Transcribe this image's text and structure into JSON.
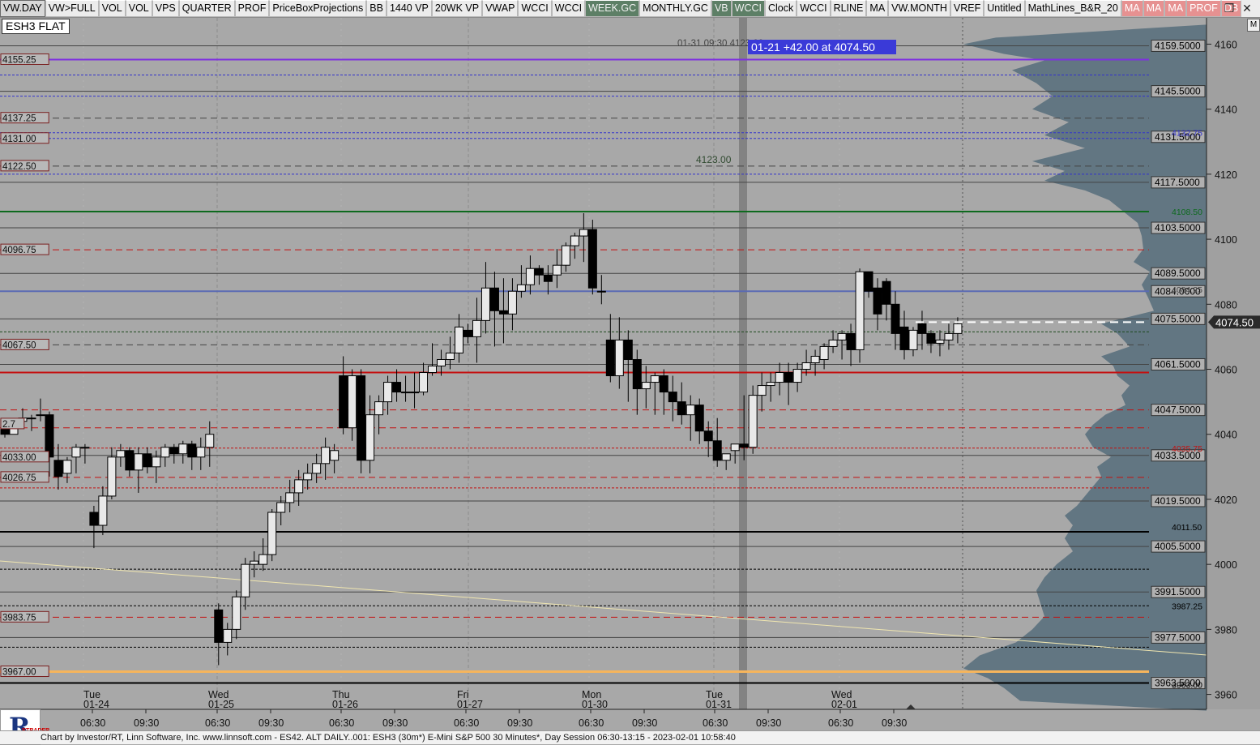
{
  "toolbar": {
    "items": [
      {
        "label": "VW.DAY",
        "style": "active"
      },
      {
        "label": "VW>FULL",
        "style": ""
      },
      {
        "label": "VOL",
        "style": ""
      },
      {
        "label": "VOL",
        "style": ""
      },
      {
        "label": "VPS",
        "style": ""
      },
      {
        "label": "QUARTER",
        "style": ""
      },
      {
        "label": "PROF",
        "style": ""
      },
      {
        "label": "PriceBoxProjections",
        "style": ""
      },
      {
        "label": "BB",
        "style": ""
      },
      {
        "label": "1440 VP",
        "style": ""
      },
      {
        "label": "20WK VP",
        "style": ""
      },
      {
        "label": "VWAP",
        "style": ""
      },
      {
        "label": "WCCI",
        "style": ""
      },
      {
        "label": "WCCI",
        "style": ""
      },
      {
        "label": "WEEK.GC",
        "style": "green"
      },
      {
        "label": "MONTHLY.GC",
        "style": ""
      },
      {
        "label": "VB",
        "style": "green"
      },
      {
        "label": "WCCI",
        "style": "green"
      },
      {
        "label": "Clock",
        "style": ""
      },
      {
        "label": "WCCI",
        "style": ""
      },
      {
        "label": "RLINE",
        "style": ""
      },
      {
        "label": "MA",
        "style": ""
      },
      {
        "label": "VW.MONTH",
        "style": ""
      },
      {
        "label": "VREF",
        "style": ""
      },
      {
        "label": "Untitled",
        "style": ""
      },
      {
        "label": "MathLines_B&R_20",
        "style": ""
      },
      {
        "label": "MA",
        "style": "red"
      },
      {
        "label": "MA",
        "style": "red"
      },
      {
        "label": "MA",
        "style": "red"
      },
      {
        "label": "PROF",
        "style": "red"
      },
      {
        "label": "DB",
        "style": "red"
      }
    ],
    "window_controls": [
      "❐",
      "✕"
    ]
  },
  "symbol": "ESH3 FLAT",
  "m_button": "M",
  "footer_text": "Chart by Investor/RT, Linn Software, Inc. www.linnsoft.com - ES42.  ALT DAILY..001: ESH3 (30m*) E-Mini S&P 500 30 Minutes*, Day Session 06:30-13:15 - 2023-02-01 10:58:40",
  "logo_text": "R",
  "logo_subtext": "RTRADER",
  "colors": {
    "bg": "#a8a8a8",
    "profile": "#5e7380",
    "purple": "#7e2fe0",
    "red": "#c41010",
    "green": "#0e6a1e",
    "orange": "#f6b55c",
    "blue": "#5a6ab4",
    "label_blue": "#3333cc"
  },
  "chart_data": {
    "type": "candlestick",
    "title": "ESH3 (30m*) E-Mini S&P 500 30 Minutes",
    "y_ticks": [
      4160,
      4140,
      4120,
      4100,
      4080,
      4060,
      4040,
      4020,
      4000,
      3980,
      3960
    ],
    "last_price": "4074.50",
    "price_annotation": "01-21 +42.00 at 4074.50",
    "price_annotation_ghost": "01-31 09:30 4123.00",
    "level_4123": "4123.00",
    "x_days": [
      {
        "day": "Tue",
        "date": "01-24",
        "times": [
          "06:30",
          "09:30"
        ]
      },
      {
        "day": "Wed",
        "date": "01-25",
        "times": [
          "06:30",
          "09:30"
        ]
      },
      {
        "day": "Thu",
        "date": "01-26",
        "times": [
          "06:30",
          "09:30"
        ]
      },
      {
        "day": "Fri",
        "date": "01-27",
        "times": [
          "06:30",
          "09:30"
        ]
      },
      {
        "day": "Mon",
        "date": "01-30",
        "times": [
          "06:30",
          "09:30"
        ]
      },
      {
        "day": "Tue",
        "date": "01-31",
        "times": [
          "06:30",
          "09:30"
        ]
      },
      {
        "day": "Wed",
        "date": "02-01",
        "times": [
          "06:30",
          "09:30"
        ]
      }
    ],
    "left_labels": [
      "4155.25",
      "4137.25",
      "4131.00",
      "4122.50",
      "4096.75",
      "4067.50",
      "2.7",
      "4033.00",
      "4026.75",
      "3983.75",
      "3967.00"
    ],
    "left_label_prices": [
      4155.25,
      4137.25,
      4131.0,
      4122.5,
      4096.75,
      4067.5,
      4043.2,
      4033.0,
      4026.75,
      3983.75,
      3967.0
    ],
    "right_box_labels": [
      "4159.5000",
      "4145.5000",
      "4131.5000",
      "4117.5000",
      "4103.5000",
      "4089.5000",
      "4084.0000",
      "4075.5000",
      "4061.5000",
      "4047.5000",
      "4033.5000",
      "4019.5000",
      "4005.5000",
      "3991.5000",
      "3977.5000",
      "3963.5000"
    ],
    "right_plain_labels": [
      {
        "text": "4132.75",
        "price": 4132.75,
        "color": "#3333cc"
      },
      {
        "text": "4108.50",
        "price": 4108.5,
        "color": "#0e6a1e"
      },
      {
        "text": "4084.25",
        "price": 4084.6,
        "color": "#444"
      },
      {
        "text": "4035.75",
        "price": 4035.75,
        "color": "#c41010"
      },
      {
        "text": "4011.50",
        "price": 4011.5,
        "color": "#000"
      },
      {
        "text": "3987.25",
        "price": 3987.25,
        "color": "#000"
      },
      {
        "text": "3963.00",
        "price": 3963.0,
        "color": "#000"
      }
    ],
    "h_lines": [
      {
        "p": 4155.25,
        "c": "#7e2fe0",
        "w": 2,
        "d": ""
      },
      {
        "p": 4159.5,
        "c": "#444",
        "w": 1,
        "d": ""
      },
      {
        "p": 4150.5,
        "c": "#3333cc",
        "w": 1,
        "d": "3,2"
      },
      {
        "p": 4145.5,
        "c": "#444",
        "w": 1,
        "d": ""
      },
      {
        "p": 4144.0,
        "c": "#3333cc",
        "w": 1,
        "d": "3,2"
      },
      {
        "p": 4137.25,
        "c": "#444",
        "w": 1,
        "d": "8,5"
      },
      {
        "p": 4132.75,
        "c": "#3333cc",
        "w": 1,
        "d": "3,2"
      },
      {
        "p": 4131.0,
        "c": "#3333cc",
        "w": 1,
        "d": "3,2"
      },
      {
        "p": 4122.5,
        "c": "#444",
        "w": 1,
        "d": "8,5"
      },
      {
        "p": 4120.0,
        "c": "#3333cc",
        "w": 1,
        "d": "3,2"
      },
      {
        "p": 4117.5,
        "c": "#444",
        "w": 1,
        "d": ""
      },
      {
        "p": 4108.5,
        "c": "#0e6a1e",
        "w": 2,
        "d": ""
      },
      {
        "p": 4103.5,
        "c": "#444",
        "w": 1,
        "d": ""
      },
      {
        "p": 4096.75,
        "c": "#c41010",
        "w": 1,
        "d": "8,5"
      },
      {
        "p": 4089.5,
        "c": "#444",
        "w": 1,
        "d": ""
      },
      {
        "p": 4084.0,
        "c": "#5a6ab4",
        "w": 2,
        "d": ""
      },
      {
        "p": 4075.5,
        "c": "#444",
        "w": 1,
        "d": ""
      },
      {
        "p": 4071.5,
        "c": "#1e4a1e",
        "w": 1,
        "d": "3,2"
      },
      {
        "p": 4067.5,
        "c": "#444",
        "w": 1,
        "d": "8,5"
      },
      {
        "p": 4061.5,
        "c": "#444",
        "w": 1,
        "d": ""
      },
      {
        "p": 4059.0,
        "c": "#c41010",
        "w": 2,
        "d": ""
      },
      {
        "p": 4047.5,
        "c": "#c41010",
        "w": 1,
        "d": "8,5"
      },
      {
        "p": 4042.0,
        "c": "#c41010",
        "w": 1,
        "d": "8,5"
      },
      {
        "p": 4035.75,
        "c": "#c41010",
        "w": 1,
        "d": "3,2"
      },
      {
        "p": 4033.5,
        "c": "#444",
        "w": 1,
        "d": ""
      },
      {
        "p": 4026.75,
        "c": "#c41010",
        "w": 1,
        "d": "8,5"
      },
      {
        "p": 4023.5,
        "c": "#c41010",
        "w": 1,
        "d": "3,2"
      },
      {
        "p": 4019.5,
        "c": "#444",
        "w": 1,
        "d": ""
      },
      {
        "p": 4010.0,
        "c": "#000",
        "w": 2,
        "d": ""
      },
      {
        "p": 4005.5,
        "c": "#444",
        "w": 1,
        "d": ""
      },
      {
        "p": 3998.5,
        "c": "#000",
        "w": 1,
        "d": "3,2"
      },
      {
        "p": 3991.5,
        "c": "#444",
        "w": 1,
        "d": ""
      },
      {
        "p": 3987.25,
        "c": "#000",
        "w": 1,
        "d": "3,2"
      },
      {
        "p": 3983.75,
        "c": "#c41010",
        "w": 1,
        "d": "8,5"
      },
      {
        "p": 3977.5,
        "c": "#444",
        "w": 1,
        "d": ""
      },
      {
        "p": 3974.5,
        "c": "#000",
        "w": 1,
        "d": "3,2"
      },
      {
        "p": 3967.0,
        "c": "#f6b55c",
        "w": 3,
        "d": ""
      },
      {
        "p": 3963.5,
        "c": "#000",
        "w": 2,
        "d": ""
      }
    ],
    "candles": [
      [
        4044,
        4045,
        4039,
        4040
      ],
      [
        4040,
        4045,
        4040,
        4044
      ],
      [
        4044,
        4048,
        4043,
        4045
      ],
      [
        4045,
        4046,
        4041,
        4045
      ],
      [
        4046,
        4051,
        4044,
        4046
      ],
      [
        4046,
        4047,
        4027,
        4033
      ],
      [
        4032,
        4037,
        4023,
        4027
      ],
      [
        4028,
        4033,
        4025,
        4032
      ],
      [
        4033,
        4037,
        4028,
        4036
      ],
      [
        4036,
        4037,
        4031,
        4036
      ],
      [
        4016,
        4018,
        4005,
        4012
      ],
      [
        4012,
        4024,
        4009,
        4021
      ],
      [
        4021,
        4036,
        4020,
        4033
      ],
      [
        4033,
        4037,
        4030,
        4035
      ],
      [
        4035,
        4036,
        4027,
        4029
      ],
      [
        4029,
        4036,
        4022,
        4034
      ],
      [
        4034,
        4036,
        4028,
        4030
      ],
      [
        4030,
        4035,
        4025,
        4033
      ],
      [
        4033,
        4037,
        4030,
        4036
      ],
      [
        4036,
        4037,
        4031,
        4034
      ],
      [
        4034,
        4038,
        4031,
        4037
      ],
      [
        4037,
        4038,
        4029,
        4033
      ],
      [
        4033,
        4039,
        4029,
        4036
      ],
      [
        4036,
        4044,
        4030,
        4040
      ],
      [
        3986,
        3988,
        3969,
        3976
      ],
      [
        3976,
        3982,
        3972,
        3980
      ],
      [
        3980,
        3992,
        3977,
        3990
      ],
      [
        3990,
        4002,
        3986,
        4000
      ],
      [
        4000,
        4004,
        3996,
        4001
      ],
      [
        4000,
        4008,
        3998,
        4003
      ],
      [
        4003,
        4017,
        4001,
        4016
      ],
      [
        4016,
        4021,
        4012,
        4019
      ],
      [
        4019,
        4026,
        4016,
        4022
      ],
      [
        4022,
        4029,
        4018,
        4026
      ],
      [
        4026,
        4031,
        4023,
        4028
      ],
      [
        4028,
        4034,
        4025,
        4031
      ],
      [
        4031,
        4039,
        4026,
        4036
      ],
      [
        4032,
        4037,
        4028,
        4035
      ],
      [
        4058,
        4064,
        4040,
        4042
      ],
      [
        4042,
        4060,
        4038,
        4058
      ],
      [
        4058,
        4060,
        4028,
        4032
      ],
      [
        4032,
        4052,
        4028,
        4046
      ],
      [
        4046,
        4052,
        4040,
        4050
      ],
      [
        4050,
        4058,
        4046,
        4056
      ],
      [
        4056,
        4060,
        4050,
        4053
      ],
      [
        4053,
        4058,
        4050,
        4053
      ],
      [
        4053,
        4059,
        4048,
        4053
      ],
      [
        4053,
        4062,
        4052,
        4059
      ],
      [
        4059,
        4068,
        4058,
        4061
      ],
      [
        4061,
        4066,
        4058,
        4063
      ],
      [
        4063,
        4070,
        4060,
        4065
      ],
      [
        4065,
        4077,
        4062,
        4073
      ],
      [
        4072,
        4074,
        4068,
        4070
      ],
      [
        4070,
        4082,
        4062,
        4075
      ],
      [
        4075,
        4093,
        4071,
        4085
      ],
      [
        4085,
        4090,
        4067,
        4078
      ],
      [
        4078,
        4088,
        4068,
        4077
      ],
      [
        4077,
        4088,
        4072,
        4084
      ],
      [
        4084,
        4092,
        4082,
        4086
      ],
      [
        4086,
        4095,
        4083,
        4091
      ],
      [
        4091,
        4092,
        4086,
        4089
      ],
      [
        4089,
        4092,
        4083,
        4087
      ],
      [
        4089,
        4097,
        4085,
        4092
      ],
      [
        4092,
        4099,
        4090,
        4098
      ],
      [
        4098,
        4102,
        4094,
        4101
      ],
      [
        4101,
        4108,
        4093,
        4103
      ],
      [
        4103,
        4106,
        4083,
        4085
      ],
      [
        4084,
        4089,
        4080,
        4084
      ],
      [
        4069,
        4077,
        4056,
        4058
      ],
      [
        4058,
        4076,
        4054,
        4069
      ],
      [
        4069,
        4072,
        4050,
        4063
      ],
      [
        4063,
        4066,
        4046,
        4054
      ],
      [
        4054,
        4061,
        4048,
        4056
      ],
      [
        4056,
        4059,
        4046,
        4058
      ],
      [
        4058,
        4060,
        4046,
        4053
      ],
      [
        4053,
        4058,
        4044,
        4050
      ],
      [
        4050,
        4056,
        4043,
        4046
      ],
      [
        4046,
        4052,
        4038,
        4049
      ],
      [
        4049,
        4051,
        4037,
        4041
      ],
      [
        4041,
        4044,
        4033,
        4038
      ],
      [
        4038,
        4045,
        4030,
        4032
      ],
      [
        4032,
        4034,
        4029,
        4034
      ],
      [
        4035,
        4037,
        4031,
        4037
      ],
      [
        4037,
        4052,
        4032,
        4036
      ],
      [
        4036,
        4055,
        4034,
        4052
      ],
      [
        4052,
        4059,
        4047,
        4055
      ],
      [
        4055,
        4059,
        4050,
        4056
      ],
      [
        4056,
        4062,
        4052,
        4059
      ],
      [
        4059,
        4062,
        4049,
        4056
      ],
      [
        4056,
        4062,
        4053,
        4060
      ],
      [
        4060,
        4066,
        4058,
        4062
      ],
      [
        4062,
        4066,
        4058,
        4064
      ],
      [
        4063,
        4068,
        4060,
        4067
      ],
      [
        4067,
        4072,
        4065,
        4069
      ],
      [
        4069,
        4072,
        4063,
        4071
      ],
      [
        4071,
        4074,
        4061,
        4066
      ],
      [
        4066,
        4091,
        4062,
        4090
      ],
      [
        4090,
        4090,
        4082,
        4084
      ],
      [
        4085,
        4088,
        4072,
        4077
      ],
      [
        4087,
        4088,
        4075,
        4080
      ],
      [
        4080,
        4084,
        4066,
        4071
      ],
      [
        4073,
        4078,
        4063,
        4066
      ],
      [
        4066,
        4073,
        4064,
        4072
      ],
      [
        4074,
        4078,
        4066,
        4071
      ],
      [
        4071,
        4072,
        4065,
        4068
      ],
      [
        4068,
        4072,
        4064,
        4069
      ],
      [
        4069,
        4074,
        4066,
        4071
      ],
      [
        4071,
        4076,
        4068,
        4074
      ]
    ]
  }
}
